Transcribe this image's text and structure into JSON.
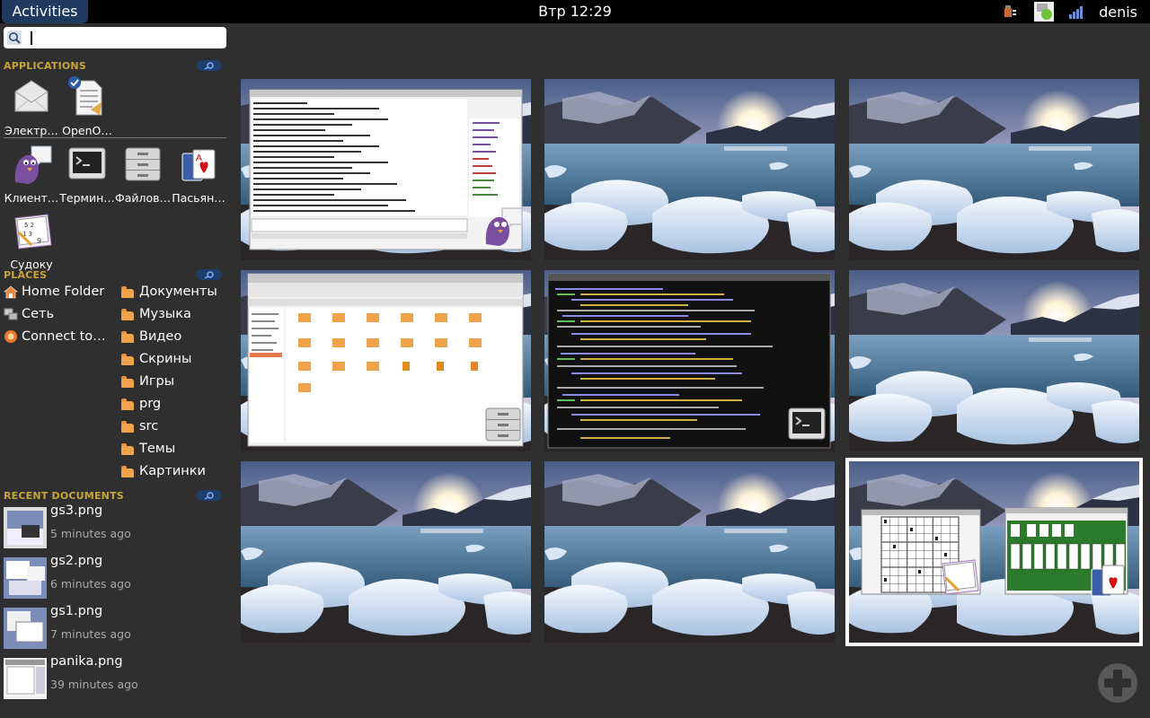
{
  "panel": {
    "activities_label": "Activities",
    "clock": "Втр 12:29",
    "user": "denis"
  },
  "sidebar": {
    "applications_title": "APPLICATIONS",
    "apps": [
      {
        "label": "Электр…",
        "icon": "mail-envelope-icon"
      },
      {
        "label": "OpenO…",
        "icon": "document-writer-icon"
      },
      {
        "label": "Клиент…",
        "icon": "pidgin-chat-icon"
      },
      {
        "label": "Термин…",
        "icon": "terminal-icon"
      },
      {
        "label": "Файлов…",
        "icon": "file-cabinet-icon"
      },
      {
        "label": "Пасьян…",
        "icon": "playing-cards-icon"
      },
      {
        "label": "Судоку",
        "icon": "sudoku-icon"
      }
    ],
    "places_title": "PLACES",
    "places_left": [
      {
        "label": "Home Folder",
        "icon": "home-icon"
      },
      {
        "label": "Сеть",
        "icon": "network-icon"
      },
      {
        "label": "Connect to…",
        "icon": "connect-server-icon"
      }
    ],
    "places_right": [
      "Документы",
      "Музыка",
      "Видео",
      "Скрины",
      "Игры",
      "prg",
      "src",
      "Темы",
      "Картинки"
    ],
    "recent_title": "RECENT DOCUMENTS",
    "recent": [
      {
        "name": "gs3.png",
        "time": "5 minutes ago"
      },
      {
        "name": "gs2.png",
        "time": "6 minutes ago"
      },
      {
        "name": "gs1.png",
        "time": "7 minutes ago"
      },
      {
        "name": "panika.png",
        "time": "39 minutes ago"
      }
    ]
  },
  "colors": {
    "panel_bg": "#000000",
    "overview_bg": "#2f2f2f",
    "activities_bg": "#1f3a5f",
    "section_title": "#c9a43a",
    "folder": "#f0a34a"
  },
  "workspaces": [
    {
      "content": "pidgin-chat-window"
    },
    {
      "content": "empty-desktop"
    },
    {
      "content": "empty-desktop"
    },
    {
      "content": "file-manager-window"
    },
    {
      "content": "terminal-window"
    },
    {
      "content": "empty-desktop"
    },
    {
      "content": "empty-desktop"
    },
    {
      "content": "empty-desktop"
    },
    {
      "content": "sudoku-and-solitaire-windows",
      "selected": true
    }
  ]
}
